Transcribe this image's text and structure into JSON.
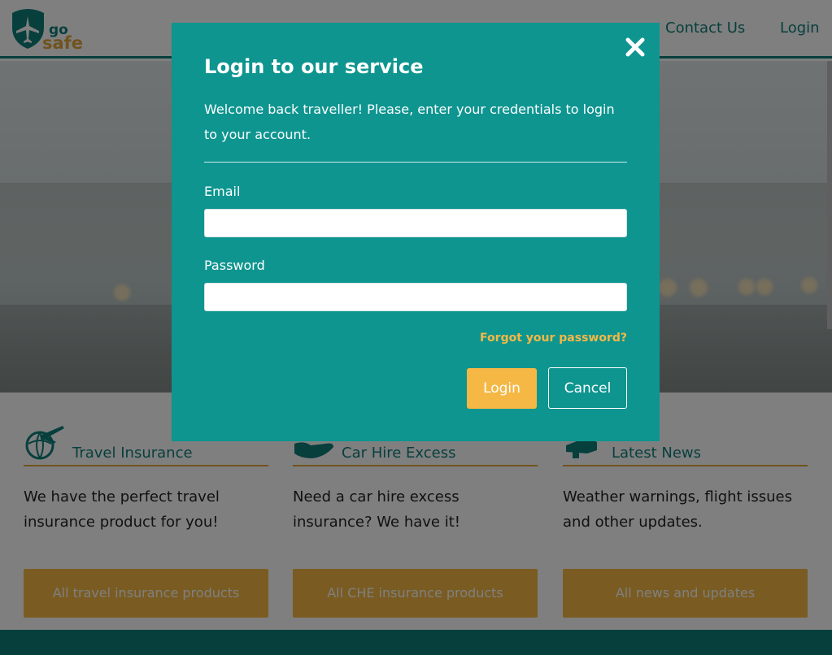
{
  "header": {
    "logo_text_top": "go",
    "logo_text_bottom": "safe",
    "nav": {
      "contact_label": "Contact Us",
      "login_label": "Login"
    }
  },
  "features": [
    {
      "title": "Travel Insurance",
      "text": "We have the perfect travel insurance product for you!",
      "button": "All travel insurance products",
      "icon": "airplane-globe-icon"
    },
    {
      "title": "Car Hire Excess",
      "text": "Need a car hire excess insurance? We have it!",
      "button": "All CHE insurance products",
      "icon": "hand-car-icon"
    },
    {
      "title": "Latest News",
      "text": "Weather warnings, flight issues and other updates.",
      "button": "All news and updates",
      "icon": "megaphone-icon"
    }
  ],
  "modal": {
    "title": "Login to our service",
    "description": "Welcome back traveller! Please, enter your credentials to login to your account.",
    "email_label": "Email",
    "email_value": "",
    "password_label": "Password",
    "password_value": "",
    "forgot_label": "Forgot your password?",
    "login_button": "Login",
    "cancel_button": "Cancel",
    "close_icon": "close-icon"
  },
  "colors": {
    "brand_teal": "#0f7f7b",
    "modal_teal": "#0e9590",
    "accent_orange": "#f5b845"
  }
}
